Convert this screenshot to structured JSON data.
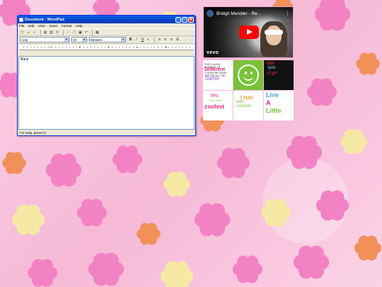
{
  "desktop": {
    "wallpaper_colors": {
      "pink_petal": "#f382c5",
      "light_petal": "#f6e9a6",
      "orange_petal": "#f2905a",
      "background": "#f9c4de"
    }
  },
  "wordpad": {
    "title": "Document - WordPad",
    "buttons": {
      "minimize": "_",
      "maximize": "□",
      "close": "×"
    },
    "menu": [
      "File",
      "Edit",
      "View",
      "Insert",
      "Format",
      "Help"
    ],
    "toolbar_icons": [
      "new-icon",
      "open-icon",
      "save-icon",
      "print-icon",
      "print-preview-icon",
      "find-icon",
      "cut-icon",
      "copy-icon",
      "paste-icon",
      "undo-icon",
      "date-time-icon"
    ],
    "font_name": "Arial",
    "font_size": "10",
    "script": "Western",
    "format_icons": [
      "bold-icon",
      "italic-icon",
      "underline-icon",
      "color-icon",
      "align-left-icon",
      "align-center-icon",
      "align-right-icon",
      "bullets-icon"
    ],
    "ruler_numbers": [
      "1",
      "2",
      "3",
      "4",
      "5"
    ],
    "document_text": "Back",
    "status_text": "For Help, press F1"
  },
  "video": {
    "title": "Bridgit Mendler - Re...",
    "menu_glyph": "⋮",
    "brand": "vevo"
  },
  "tiles": [
    {
      "name": "tile-same",
      "lines": [
        "THEY LAUGH",
        "BECAUSE I'M",
        "Different",
        "I LAUGH BECAUSE",
        "THEY'RE ALL THE",
        "Same"
      ]
    },
    {
      "name": "tile-smiley"
    },
    {
      "name": "tile-little-lyric",
      "lines": [
        "little",
        "lyric",
        "of girl"
      ]
    },
    {
      "name": "tile-lover",
      "lines": [
        "Yes",
        "I'm a lover",
        "coolest"
      ]
    },
    {
      "name": "tile-run",
      "lines": [
        "I run",
        "with",
        "scissors"
      ]
    },
    {
      "name": "tile-live",
      "lines": [
        "Live",
        "A",
        "Little"
      ]
    }
  ]
}
